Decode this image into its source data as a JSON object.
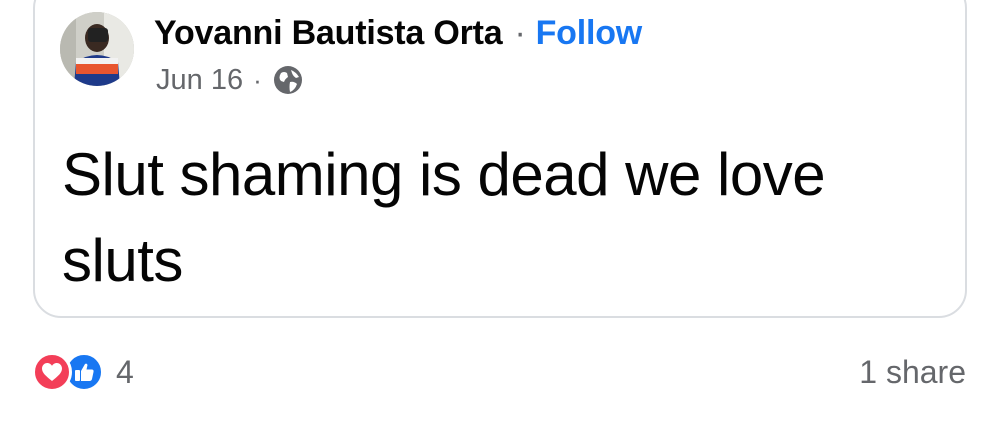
{
  "post": {
    "author": "Yovanni Bautista Orta",
    "separator": "·",
    "follow_label": "Follow",
    "date": "Jun 16",
    "meta_separator": "·",
    "privacy_icon": "globe-icon",
    "text": "Slut shaming is dead we love sluts"
  },
  "footer": {
    "reaction_icons": [
      "love-icon",
      "like-icon"
    ],
    "reaction_count": "4",
    "share_count": "1 share"
  },
  "colors": {
    "link": "#1877f2",
    "secondary_text": "#65676b",
    "primary_text": "#050505",
    "love": "#f33e58",
    "like": "#1877f2",
    "border": "#dadde1"
  }
}
